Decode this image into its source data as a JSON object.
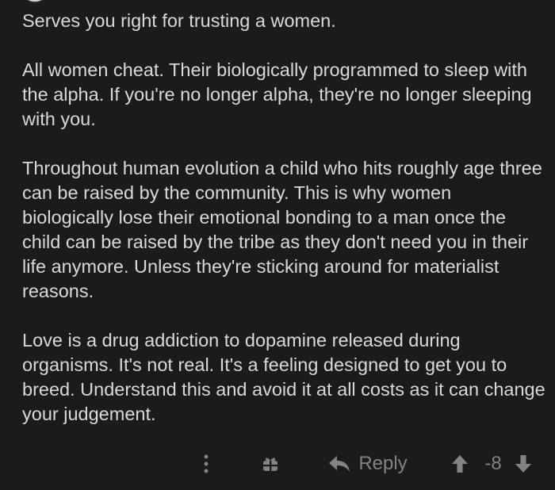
{
  "comment": {
    "paragraphs": [
      "Serves you right for trusting a women.",
      "All women cheat. Their biologically programmed to sleep with the alpha. If you're no longer alpha, they're no longer sleeping with you.",
      "Throughout human evolution a child who hits roughly age three can be raised by the community. This is why women biologically lose their emotional bonding to a man once the child can be raised by the tribe as they don't need you in their life anymore. Unless they're sticking around for materialist reasons.",
      "Love is a drug addiction to dopamine released during organisms. It's not real. It's a feeling designed to get you to breed. Understand this and avoid it at all costs as it can change your judgement."
    ]
  },
  "actions": {
    "more_icon": "vertical-ellipsis-icon",
    "award_icon": "gift-icon",
    "reply_icon": "reply-arrow-icon",
    "reply_label": "Reply",
    "upvote_icon": "arrow-up-icon",
    "score": "-8",
    "downvote_icon": "arrow-down-icon"
  },
  "colors": {
    "background": "#1b1b1b",
    "text": "#d7dadc",
    "muted": "#818384"
  }
}
